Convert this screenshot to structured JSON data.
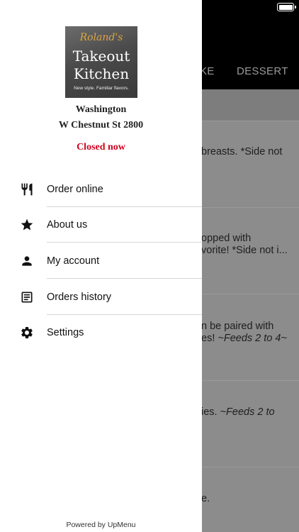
{
  "background": {
    "tabs": [
      "KE",
      "DESSERT"
    ],
    "items": [
      {
        "lines": [
          "breasts. *Side not"
        ]
      },
      {
        "lines": [
          "opped with",
          "vorite! *Side not i..."
        ]
      },
      {
        "lines": [
          "n be paired with",
          "es! "
        ],
        "italic": "~Feeds 2 to 4~"
      },
      {
        "lines": [
          "ies. "
        ],
        "italic": "~Feeds 2 to"
      },
      {
        "lines": [
          "e."
        ]
      }
    ]
  },
  "drawer": {
    "logo": {
      "script": "Roland's",
      "line1": "Takeout",
      "line2": "Kitchen",
      "tagline": "New style. Familiar flavors."
    },
    "city": "Washington",
    "address": "W Chestnut St 2800",
    "status": "Closed now",
    "status_color": "#d0021b",
    "menu": [
      {
        "label": "Order online",
        "icon": "fork-knife-icon"
      },
      {
        "label": "About us",
        "icon": "star-icon"
      },
      {
        "label": "My account",
        "icon": "person-icon"
      },
      {
        "label": "Orders history",
        "icon": "receipt-icon"
      },
      {
        "label": "Settings",
        "icon": "gear-icon"
      }
    ],
    "powered_by": "Powered by UpMenu"
  }
}
